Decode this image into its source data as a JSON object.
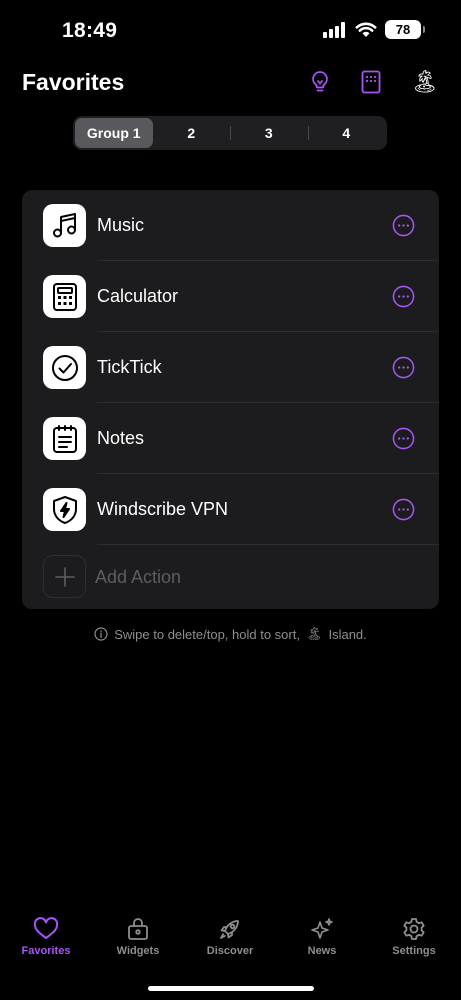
{
  "status": {
    "time": "18:49",
    "battery": "78"
  },
  "header": {
    "title": "Favorites"
  },
  "segments": [
    "Group 1",
    "2",
    "3",
    "4"
  ],
  "actions": [
    {
      "label": "Music",
      "icon": "music-note-icon"
    },
    {
      "label": "Calculator",
      "icon": "calculator-icon"
    },
    {
      "label": "TickTick",
      "icon": "checkmark-circle-icon"
    },
    {
      "label": "Notes",
      "icon": "notes-icon"
    },
    {
      "label": "Windscribe VPN",
      "icon": "shield-bolt-icon"
    }
  ],
  "add_action": {
    "label": "Add Action"
  },
  "hint": {
    "text": "Swipe to delete/top, hold to sort,",
    "emoji": "🏝",
    "suffix": "Island."
  },
  "tabs": [
    {
      "label": "Favorites",
      "icon": "heart-icon"
    },
    {
      "label": "Widgets",
      "icon": "widgets-icon"
    },
    {
      "label": "Discover",
      "icon": "rocket-icon"
    },
    {
      "label": "News",
      "icon": "sparkles-icon"
    },
    {
      "label": "Settings",
      "icon": "gear-icon"
    }
  ],
  "colors": {
    "accent": "#a855f7",
    "card": "#1c1c1e",
    "background": "#000000"
  }
}
